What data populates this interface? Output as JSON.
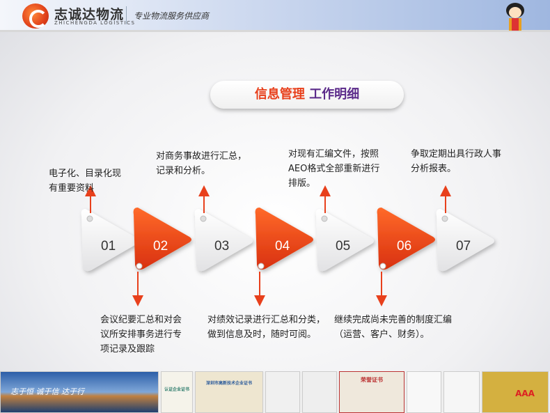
{
  "header": {
    "brand": "志诚达物流",
    "brand_en": "ZHICHENGDA LOGISTICS",
    "slogan": "专业物流服务供应商"
  },
  "title": {
    "part1": "信息管理",
    "part2": "工作明细"
  },
  "steps": [
    {
      "num": "01",
      "text": "电子化、目录化现有重要资料",
      "style": "white"
    },
    {
      "num": "02",
      "text": "会议纪要汇总和对会议所安排事务进行专项记录及跟踪",
      "style": "orange"
    },
    {
      "num": "03",
      "text": "对商务事故进行汇总，记录和分析。",
      "style": "white"
    },
    {
      "num": "04",
      "text": "对绩效记录进行汇总和分类，做到信息及时，随时可阅。",
      "style": "orange"
    },
    {
      "num": "05",
      "text": "对现有汇编文件，按照AEO格式全部重新进行排版。",
      "style": "white"
    },
    {
      "num": "06",
      "text": "继续完成尚未完善的制度汇编（运营、客户、财务）。",
      "style": "orange"
    },
    {
      "num": "07",
      "text": "争取定期出具行政人事分析报表。",
      "style": "white"
    }
  ],
  "banner": {
    "slogan": "志于恒 诚于信 达于行",
    "certs": [
      "认证企业证书",
      "深圳市高新技术企业证书",
      "荣誉证书",
      "AAA"
    ]
  },
  "colors": {
    "orange": "#e8401c",
    "purple": "#5b2a8a"
  }
}
